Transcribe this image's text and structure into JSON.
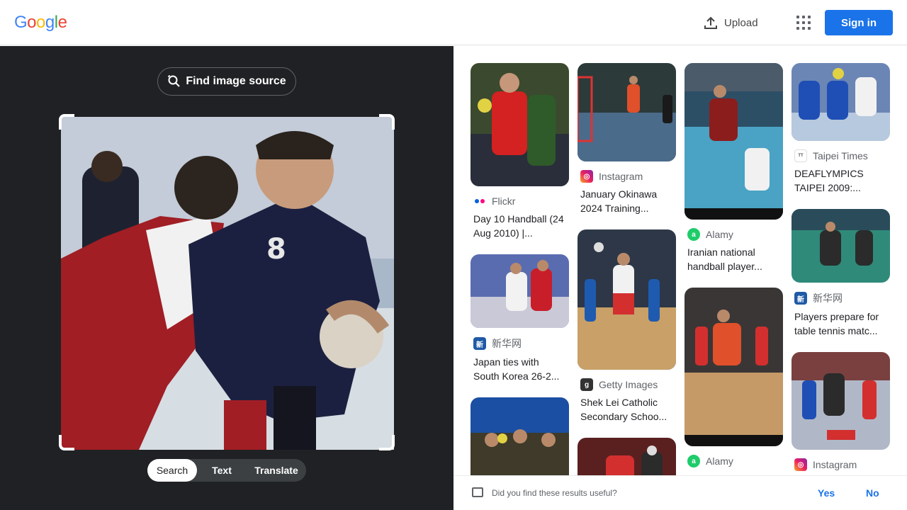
{
  "header": {
    "logo_letters": [
      "G",
      "o",
      "o",
      "g",
      "l",
      "e"
    ],
    "logo_colors": [
      "#4285F4",
      "#EA4335",
      "#FBBC05",
      "#4285F4",
      "#34A853",
      "#EA4335"
    ],
    "upload_label": "Upload",
    "signin_label": "Sign in"
  },
  "lens": {
    "find_source_label": "Find image source",
    "tabs": [
      "Search",
      "Text",
      "Translate"
    ],
    "active_tab": "Search"
  },
  "results": [
    {
      "source": "Flickr",
      "title": "Day 10 Handball (24 Aug 2010) |...",
      "icon": "flickr-icon"
    },
    {
      "source": "新华网",
      "title": "Japan ties with South Korea 26-2...",
      "icon": "xinhua-icon"
    },
    {
      "source": "Instagram",
      "title": "January Okinawa 2024 Training...",
      "icon": "instagram-icon"
    },
    {
      "source": "Getty Images",
      "title": "Shek Lei Catholic Secondary Schoo...",
      "icon": "getty-icon"
    },
    {
      "source": "Alamy",
      "title": "Iranian national handball player...",
      "icon": "alamy-icon"
    },
    {
      "source": "Alamy",
      "title": "",
      "icon": "alamy-icon"
    },
    {
      "source": "Taipei Times",
      "title": "DEAFLYMPICS TAIPEI 2009:...",
      "icon": "taipei-times-icon"
    },
    {
      "source": "新华网",
      "title": "Players prepare for table tennis matc...",
      "icon": "xinhua-icon"
    },
    {
      "source": "Instagram",
      "title": "",
      "icon": "instagram-icon"
    }
  ],
  "feedback": {
    "question": "Did you find these results useful?",
    "yes_label": "Yes",
    "no_label": "No"
  }
}
